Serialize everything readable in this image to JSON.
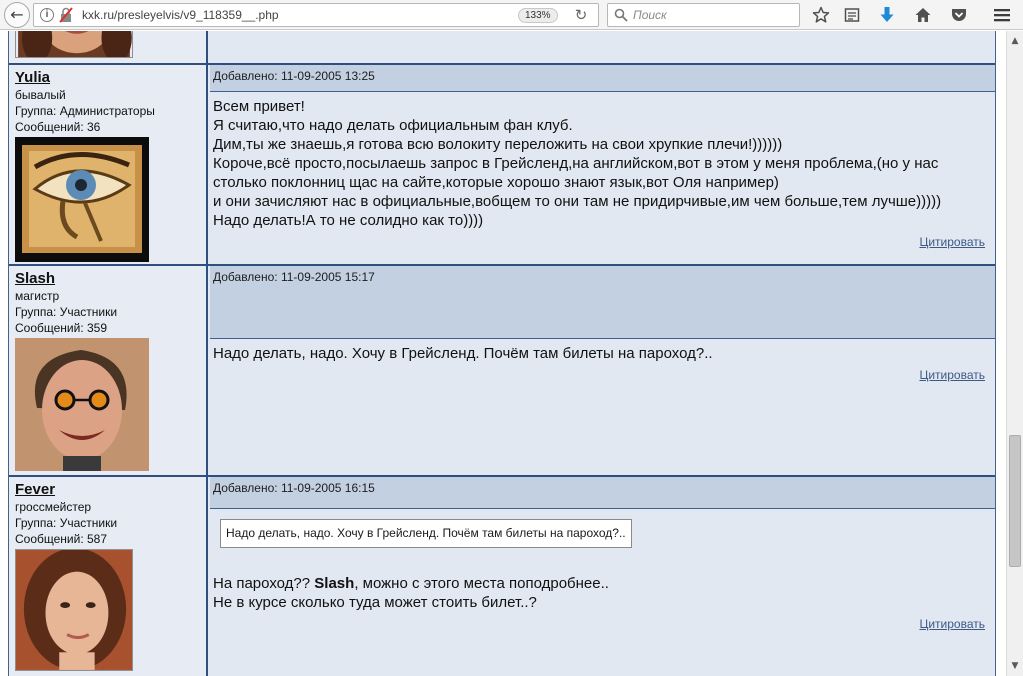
{
  "browser": {
    "url": "kxk.ru/presleyelvis/v9_118359__.php",
    "zoom": "133%",
    "search_placeholder": "Поиск",
    "icons": {
      "back": "back-arrow-icon",
      "info": "info-icon",
      "insecure": "insecure-connection-icon",
      "reload": "reload-icon",
      "search": "search-icon",
      "bookmark": "star-icon",
      "reading_list": "reading-list-icon",
      "downloads": "download-icon",
      "home": "home-icon",
      "pocket": "pocket-icon",
      "menu": "hamburger-menu-icon"
    }
  },
  "forum": {
    "quote_label": "Цитировать",
    "colors": {
      "header_bg": "#c3d0e2",
      "body_bg": "#e2e8f2",
      "border": "#2f4f7f",
      "link": "#3b5a86"
    },
    "posts": [
      {
        "username": "Yulia",
        "rank": "бывалый",
        "group": "Группа: Администраторы",
        "messages": "Сообщений: 36",
        "added": "Добавлено: 11-09-2005 13:25",
        "lines": [
          "Всем привет!",
          "Я считаю,что надо делать официальным фан клуб.",
          "Дим,ты же знаешь,я готова всю волокиту переложить на свои хрупкие плечи!))))))",
          "Короче,всё просто,посылаешь запрос в Грейсленд,на английском,вот в этом у меня проблема,(но у нас",
          "столько поклонниц щас на сайте,которые хорошо знают язык,вот Оля например)",
          "и они зачисляют нас в официальные,вобщем то они там не придирчивые,им чем больше,тем лучше)))))",
          "Надо делать!А то не солидно как то))))"
        ]
      },
      {
        "username": "Slash",
        "rank": "магистр",
        "group": "Группа: Участники",
        "messages": "Сообщений: 359",
        "added": "Добавлено: 11-09-2005 15:17",
        "lines": [
          "Надо делать, надо. Хочу в Грейсленд. Почём там билеты на пароход?.."
        ]
      },
      {
        "username": "Fever",
        "rank": "гроссмейстер",
        "group": "Группа: Участники",
        "messages": "Сообщений: 587",
        "added": "Добавлено: 11-09-2005 16:15",
        "quote": "Надо делать, надо. Хочу в Грейсленд. Почём там билеты на пароход?..",
        "line1_pre": "На пароход?? ",
        "line1_bold": "Slash",
        "line1_post": ", можно с этого места поподробнее..",
        "line2": "Не в курсе сколько туда может стоить билет..?"
      }
    ]
  }
}
